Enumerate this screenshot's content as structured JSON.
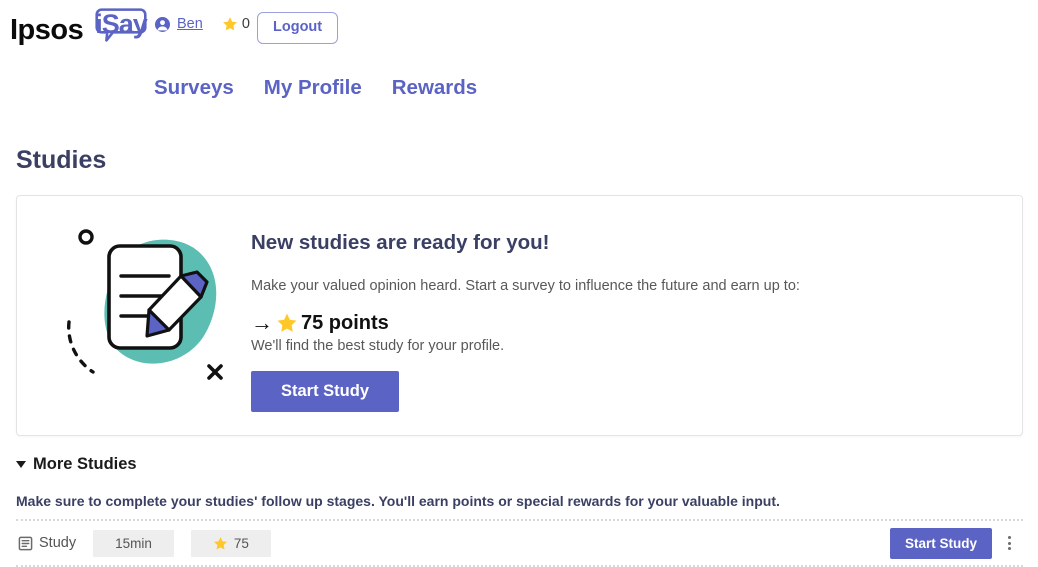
{
  "header": {
    "logo_primary": "Ipsos",
    "logo_secondary": "iSay",
    "user_icon": "person-icon",
    "user_name": "Ben",
    "star_icon": "star-icon",
    "points": "0",
    "logout_label": "Logout"
  },
  "nav": {
    "items": [
      {
        "label": "Surveys"
      },
      {
        "label": "My Profile"
      },
      {
        "label": "Rewards"
      }
    ]
  },
  "page": {
    "title": "Studies"
  },
  "hero": {
    "illustration_icon": "document-pencil-illustration",
    "title": "New studies are ready for you!",
    "subtitle": "Make your valued opinion heard. Start a survey to influence the future and earn up to:",
    "arrow_icon": "arrow-right-icon",
    "star_icon": "star-icon",
    "points_text": "75 points",
    "note": "We'll find the best study for your profile.",
    "cta_label": "Start Study"
  },
  "more_studies": {
    "caret_icon": "caret-down-icon",
    "label": "More Studies",
    "note": "Make sure to complete your studies' follow up stages. You'll earn points or special rewards for your valuable input."
  },
  "study_rows": [
    {
      "type_icon": "document-icon",
      "type_label": "Study",
      "duration": "15min",
      "points_star_icon": "star-icon",
      "points": "75",
      "cta_label": "Start Study",
      "menu_icon": "kebab-menu-icon"
    }
  ],
  "colors": {
    "brand_purple": "#5b63c4",
    "navy_text": "#3a3f63",
    "star_gold": "#ffc727",
    "teal_blob": "#5cbdb2",
    "chip_gray": "#eeeeee"
  }
}
